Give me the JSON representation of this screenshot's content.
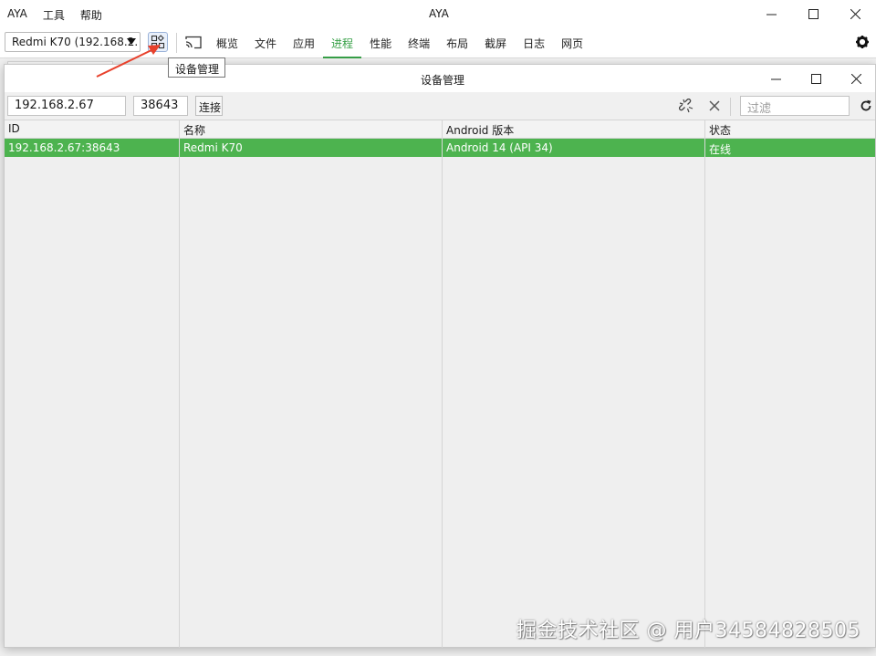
{
  "app": {
    "title": "AYA",
    "menu": [
      "AYA",
      "工具",
      "帮助"
    ],
    "window_controls": {
      "minimize": "—",
      "maximize": "☐",
      "close": "✕"
    }
  },
  "toolbar": {
    "device_selected": "Redmi K70 (192.168.2.",
    "tabs": [
      {
        "label": "概览",
        "active": false
      },
      {
        "label": "文件",
        "active": false
      },
      {
        "label": "应用",
        "active": false
      },
      {
        "label": "进程",
        "active": true
      },
      {
        "label": "性能",
        "active": false
      },
      {
        "label": "终端",
        "active": false
      },
      {
        "label": "布局",
        "active": false
      },
      {
        "label": "截屏",
        "active": false
      },
      {
        "label": "日志",
        "active": false
      },
      {
        "label": "网页",
        "active": false
      }
    ],
    "accent_color": "#37a047"
  },
  "tooltip": "设备管理",
  "dialog": {
    "title": "设备管理",
    "host_value": "192.168.2.67",
    "port_value": "38643",
    "connect_label": "连接",
    "filter_placeholder": "过滤",
    "table": {
      "headers": [
        "ID",
        "名称",
        "Android 版本",
        "状态"
      ],
      "rows": [
        [
          "192.168.2.67:38643",
          "Redmi K70",
          "Android 14 (API 34)",
          "在线"
        ]
      ],
      "selected_row_color": "#4db34f"
    }
  },
  "watermark": "掘金技术社区 @ 用户34584828505"
}
